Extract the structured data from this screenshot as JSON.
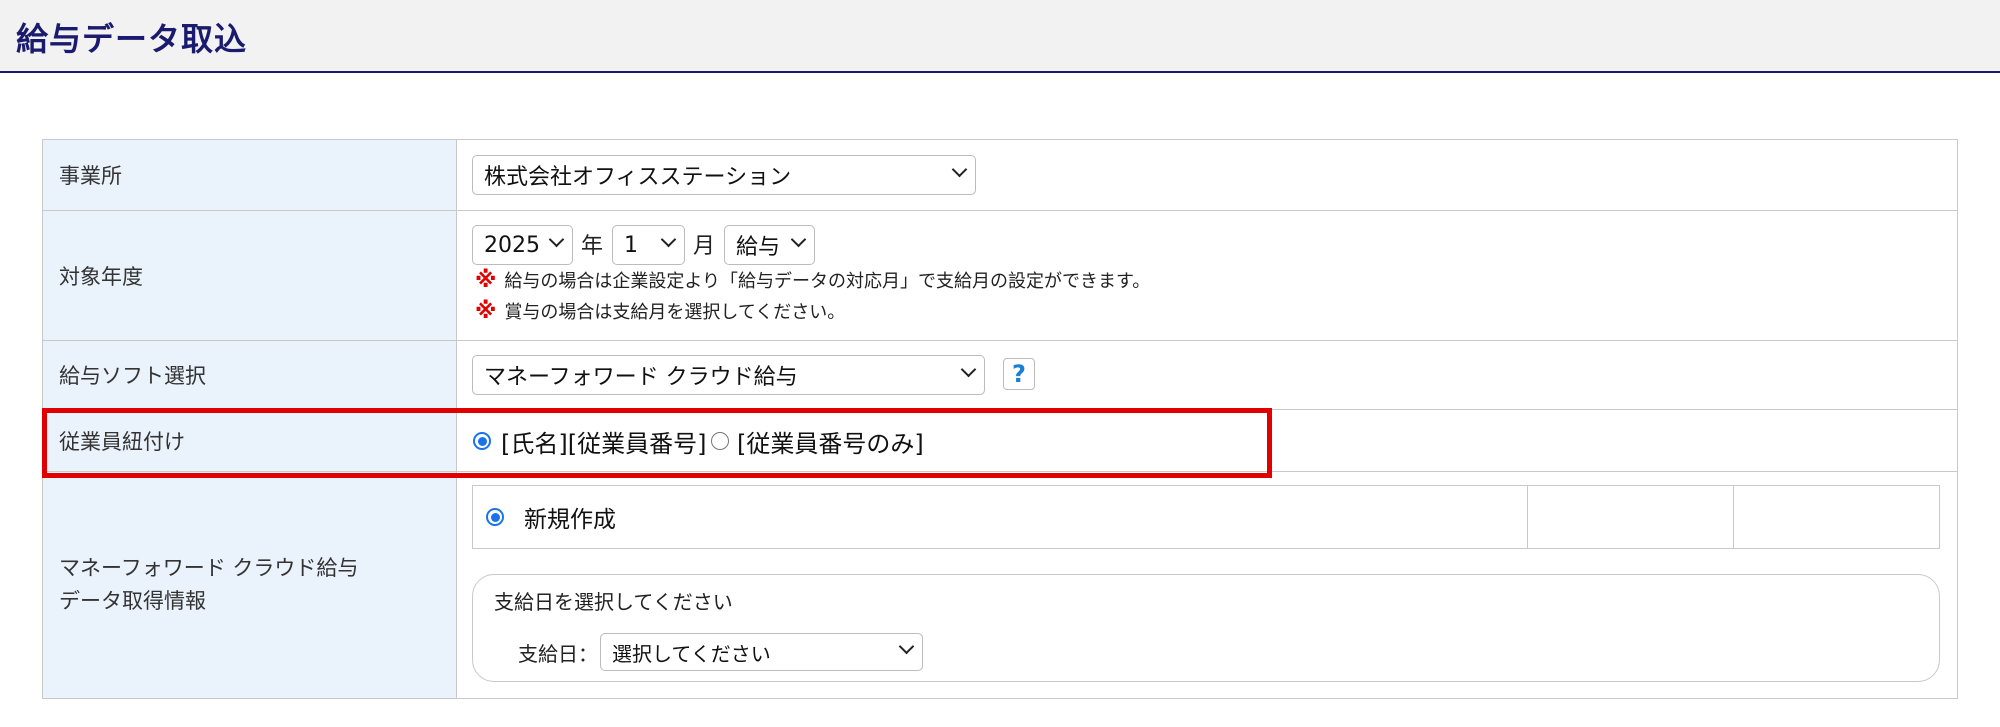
{
  "page": {
    "title": "給与データ取込"
  },
  "form": {
    "office": {
      "label": "事業所",
      "value": "株式会社オフィスステーション"
    },
    "target": {
      "label": "対象年度",
      "year": "2025",
      "year_unit": "年",
      "month": "1",
      "month_unit": "月",
      "type": "給与",
      "note_mark": "※",
      "notes": [
        "給与の場合は企業設定より「給与データの対応月」で支給月の設定ができます。",
        "賞与の場合は支給月を選択してください。"
      ]
    },
    "software": {
      "label": "給与ソフト選択",
      "value": "マネーフォワード クラウド給与",
      "help_label": "?"
    },
    "link": {
      "label": "従業員紐付け",
      "options": [
        {
          "label": "[氏名][従業員番号]",
          "selected": true
        },
        {
          "label": "[従業員番号のみ]",
          "selected": false
        }
      ]
    },
    "mf": {
      "label_line1": "マネーフォワード クラウド給与",
      "label_line2": "データ取得情報",
      "new_label": "新規作成",
      "new_selected": true,
      "paydate_prompt": "支給日を選択してください",
      "paydate_label": "支給日：",
      "paydate_value": "選択してください"
    }
  },
  "colors": {
    "title": "#1a1a6e",
    "label_bg": "#eaf2fb",
    "highlight": "#e00000",
    "radio": "#1a73e8",
    "help": "#1a7fd4"
  }
}
